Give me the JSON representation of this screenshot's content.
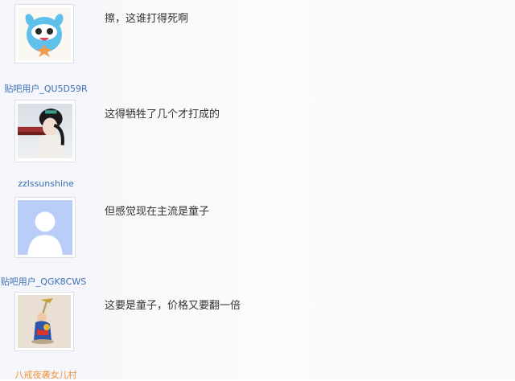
{
  "posts": [
    {
      "username": "贴吧用户_QU5D59R",
      "avatar": "cartoon-mascot-avatar",
      "text": "擦，这谁打得死啊",
      "name_color": "#3c6fb3"
    },
    {
      "username": "zzlssunshine",
      "avatar": "photo-avatar-woman-portrait",
      "text": "这得牺牲了几个才打成的",
      "name_color": "#3c6fb3"
    },
    {
      "username": "贴吧用户_QGK8CWS",
      "avatar": "default-user-avatar",
      "text": "但感觉现在主流是童子",
      "name_color": "#3c6fb3"
    },
    {
      "username": "八戒夜袭女儿村",
      "avatar": "figurine-avatar",
      "text": "这要是童子，价格又要翻一倍",
      "name_color": "#f0923a"
    }
  ]
}
